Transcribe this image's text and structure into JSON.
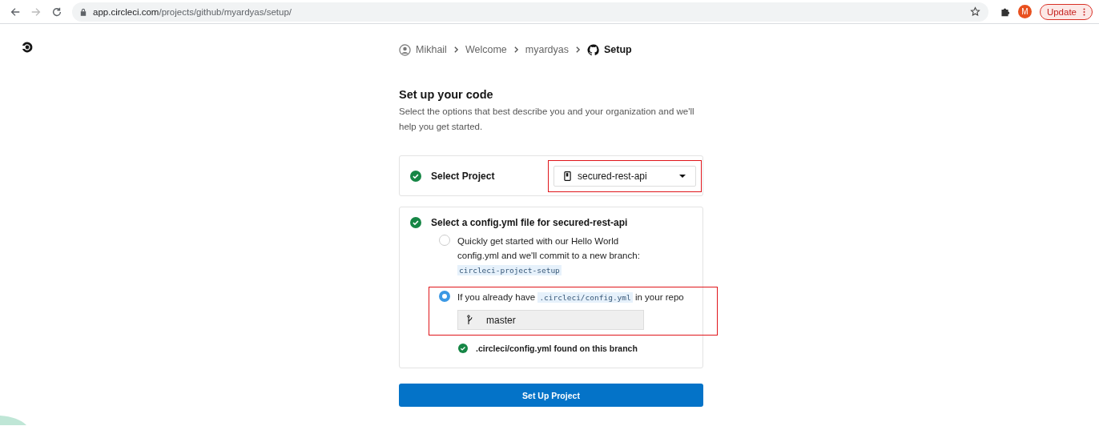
{
  "browser": {
    "url_host": "app.circleci.com",
    "url_path": "/projects/github/myardyas/setup/",
    "avatar_letter": "M",
    "update_label": "Update"
  },
  "breadcrumb": [
    {
      "kind": "user",
      "label": "Mikhail",
      "current": false
    },
    {
      "kind": "text",
      "label": "Welcome",
      "current": false
    },
    {
      "kind": "text",
      "label": "myardyas",
      "current": false
    },
    {
      "kind": "github",
      "label": "Setup",
      "current": true
    }
  ],
  "heading": "Set up your code",
  "description": "Select the options that best describe you and your organization and we'll help you get started.",
  "project_step": {
    "completed": true,
    "label": "Select Project",
    "select": {
      "value": "secured-rest-api",
      "highlighted": true
    }
  },
  "config_step": {
    "completed": true,
    "title": "Select a config.yml file for secured-rest-api",
    "options": [
      {
        "selected": false,
        "highlighted": false,
        "text_before": "Quickly get started with our Hello World config.yml and we'll commit to a new branch: ",
        "code": "circleci-project-setup"
      },
      {
        "selected": true,
        "highlighted": true,
        "text_before": "If you already have ",
        "code": ".circleci/config.yml",
        "text_after": " in your repo",
        "branch_value": "master"
      }
    ],
    "status": {
      "found": true,
      "message": ".circleci/config.yml found on this branch"
    }
  },
  "submit_label": "Set Up Project"
}
